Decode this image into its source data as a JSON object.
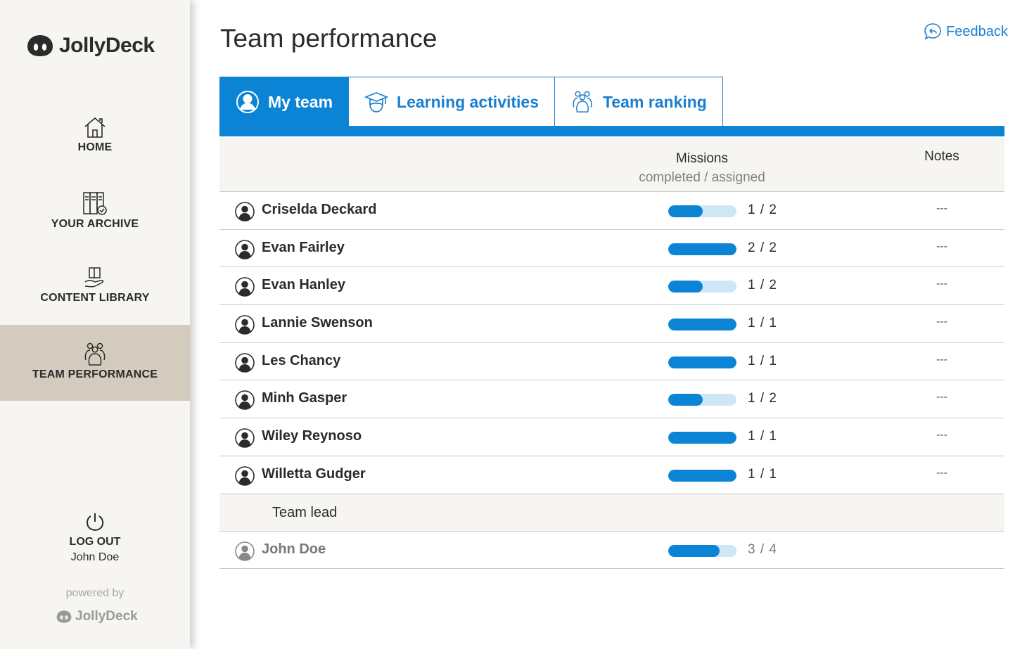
{
  "brand": {
    "name": "JollyDeck"
  },
  "sidebar": {
    "items": [
      {
        "label": "HOME",
        "icon": "home-icon"
      },
      {
        "label": "YOUR ARCHIVE",
        "icon": "archive-icon"
      },
      {
        "label": "CONTENT LIBRARY",
        "icon": "book-hand-icon"
      },
      {
        "label": "TEAM PERFORMANCE",
        "icon": "team-icon",
        "active": true
      }
    ],
    "logout": {
      "label": "LOG OUT",
      "user": "John Doe",
      "icon": "power-icon"
    },
    "powered_by": "powered by",
    "powered_brand": "JollyDeck"
  },
  "header": {
    "title": "Team performance",
    "feedback": "Feedback"
  },
  "tabs": [
    {
      "label": "My team",
      "icon": "user-circle-icon",
      "active": true
    },
    {
      "label": "Learning activities",
      "icon": "graduation-cap-icon"
    },
    {
      "label": "Team ranking",
      "icon": "team-icon"
    }
  ],
  "table": {
    "col_missions": "Missions",
    "col_missions_sub": "completed / assigned",
    "col_notes": "Notes",
    "rows": [
      {
        "name": "Criselda Deckard",
        "completed": 1,
        "assigned": 2,
        "count": "1 / 2",
        "notes": "---"
      },
      {
        "name": "Evan Fairley",
        "completed": 2,
        "assigned": 2,
        "count": "2 / 2",
        "notes": "---"
      },
      {
        "name": "Evan Hanley",
        "completed": 1,
        "assigned": 2,
        "count": "1 / 2",
        "notes": "---"
      },
      {
        "name": "Lannie Swenson",
        "completed": 1,
        "assigned": 1,
        "count": "1 / 1",
        "notes": "---"
      },
      {
        "name": "Les Chancy",
        "completed": 1,
        "assigned": 1,
        "count": "1 / 1",
        "notes": "---"
      },
      {
        "name": "Minh Gasper",
        "completed": 1,
        "assigned": 2,
        "count": "1 / 2",
        "notes": "---"
      },
      {
        "name": "Wiley Reynoso",
        "completed": 1,
        "assigned": 1,
        "count": "1 / 1",
        "notes": "---"
      },
      {
        "name": "Willetta Gudger",
        "completed": 1,
        "assigned": 1,
        "count": "1 / 1",
        "notes": "---"
      }
    ],
    "lead_section": "Team lead",
    "lead": {
      "name": "John Doe",
      "completed": 3,
      "assigned": 4,
      "count": "3 / 4"
    }
  },
  "colors": {
    "accent": "#0b84d6",
    "accent_light": "#cfe6f7",
    "sidebar_bg": "#f7f5f1",
    "sidebar_active": "#d3cbbe"
  }
}
